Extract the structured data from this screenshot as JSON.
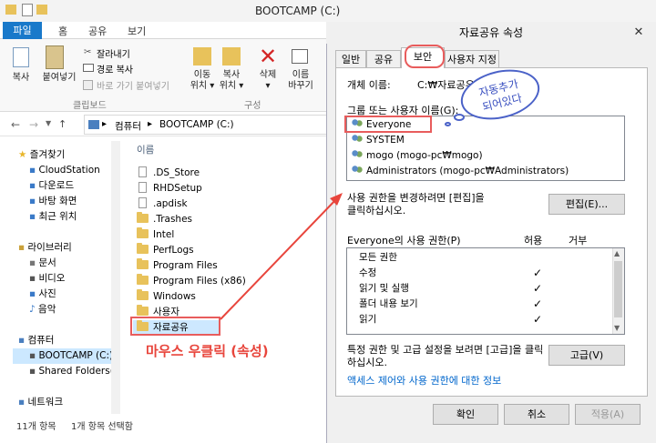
{
  "explorer": {
    "title": "BOOTCAMP (C:)",
    "tabs": [
      "파일",
      "홈",
      "공유",
      "보기"
    ],
    "ribbon": {
      "copy": "복사",
      "paste": "붙여넣기",
      "cut": "잘라내기",
      "copy_path": "경로 복사",
      "paste_shortcut": "바로 가기 붙여넣기",
      "move_to": "이동\n위치 ▾",
      "copy_to": "복사\n위치 ▾",
      "delete": "삭제\n▾",
      "rename": "이름\n바꾸기",
      "group_clipboard": "클립보드",
      "group_organize": "구성"
    },
    "breadcrumb": [
      "컴퓨터",
      "BOOTCAMP (C:)"
    ],
    "column_name": "이름",
    "nav": {
      "favorites_label": "즐겨찾기",
      "favorites": [
        "CloudStation",
        "다운로드",
        "바탕 화면",
        "최근 위치"
      ],
      "libraries_label": "라이브러리",
      "libraries": [
        "문서",
        "비디오",
        "사진",
        "음악"
      ],
      "computer_label": "컴퓨터",
      "computer_items": [
        "BOOTCAMP (C:)",
        "Shared Folders(\\\\"
      ],
      "network_label": "네트워크"
    },
    "files": [
      {
        "name": ".DS_Store",
        "type": "file"
      },
      {
        "name": "RHDSetup",
        "type": "file"
      },
      {
        "name": ".apdisk",
        "type": "file"
      },
      {
        "name": ".Trashes",
        "type": "folder"
      },
      {
        "name": "Intel",
        "type": "folder"
      },
      {
        "name": "PerfLogs",
        "type": "folder"
      },
      {
        "name": "Program Files",
        "type": "folder"
      },
      {
        "name": "Program Files (x86)",
        "type": "folder"
      },
      {
        "name": "Windows",
        "type": "folder"
      },
      {
        "name": "사용자",
        "type": "folder"
      },
      {
        "name": "자료공유",
        "type": "folder"
      }
    ],
    "status": {
      "count": "11개 항목",
      "selected": "1개 항목 선택함"
    }
  },
  "dialog": {
    "title": "자료공유 속성",
    "tabs": [
      "일반",
      "공유",
      "보안",
      "사용자 지정"
    ],
    "object_label": "개체 이름:",
    "object_value": "C:₩자료공유",
    "group_label": "그룹 또는 사용자 이름(G):",
    "users": [
      "Everyone",
      "SYSTEM",
      "mogo (mogo-pc₩mogo)",
      "Administrators (mogo-pc₩Administrators)"
    ],
    "change_text": "사용 권한을 변경하려면 [편집]을\n클릭하십시오.",
    "edit_button": "편집(E)...",
    "perm_label": "Everyone의 사용 권한(P)",
    "allow": "허용",
    "deny": "거부",
    "permissions": [
      "모든 권한",
      "수정",
      "읽기 및 실행",
      "폴더 내용 보기",
      "읽기"
    ],
    "allowed": [
      false,
      true,
      true,
      true,
      true
    ],
    "advanced_text": "특정 권한 및 고급 설정을 보려면 [고급]을 클릭\n하십시오.",
    "advanced_button": "고급(V)",
    "help_link": "액세스 제어와 사용 권한에 대한 정보",
    "ok": "확인",
    "cancel": "취소",
    "apply": "적용(A)"
  },
  "annotations": {
    "callout": "자동추가\n되어있다",
    "handnote": "마우스 우클릭 (속성)"
  },
  "colors": {
    "accent": "#1979ca",
    "annotation_red": "#e85c5c",
    "annotation_blue": "#4b62c8"
  }
}
